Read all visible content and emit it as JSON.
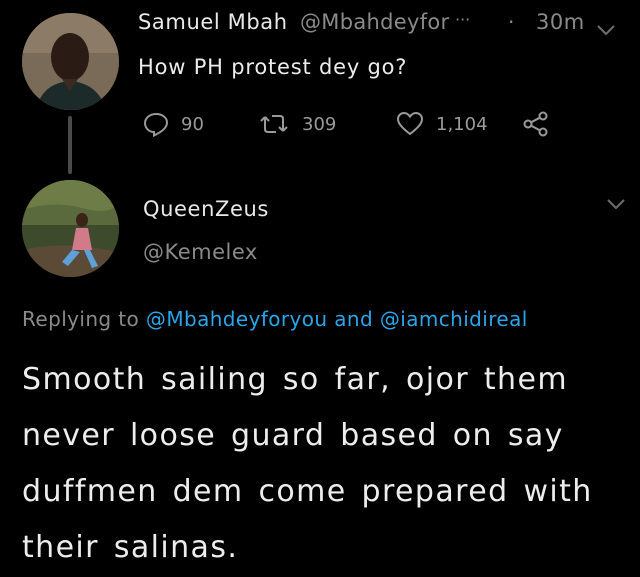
{
  "parent_tweet": {
    "name": "Samuel  Mbah",
    "handle": "@Mbahdeyfor",
    "ellipsis": "···",
    "separator": "·",
    "time": "30m",
    "text": "How PH protest dey go?",
    "replies": "90",
    "retweets": "309",
    "likes": "1,104"
  },
  "reply_tweet": {
    "name": "QueenZeus",
    "handle": "@Kemelex",
    "replying_prefix": "Replying to",
    "mention_1": "@Mbahdeyforyou",
    "conjunction": "and",
    "mention_2": "@iamchidireal",
    "text": "Smooth sailing so far, ojor them never loose guard based on say duffmen dem come prepared with their salinas."
  },
  "colors": {
    "background": "#000000",
    "mention": "#2aa6e8",
    "secondary_text": "#8a8a8a"
  },
  "icons": [
    "reply-icon",
    "retweet-icon",
    "like-icon",
    "share-icon",
    "chevron-down-icon"
  ]
}
